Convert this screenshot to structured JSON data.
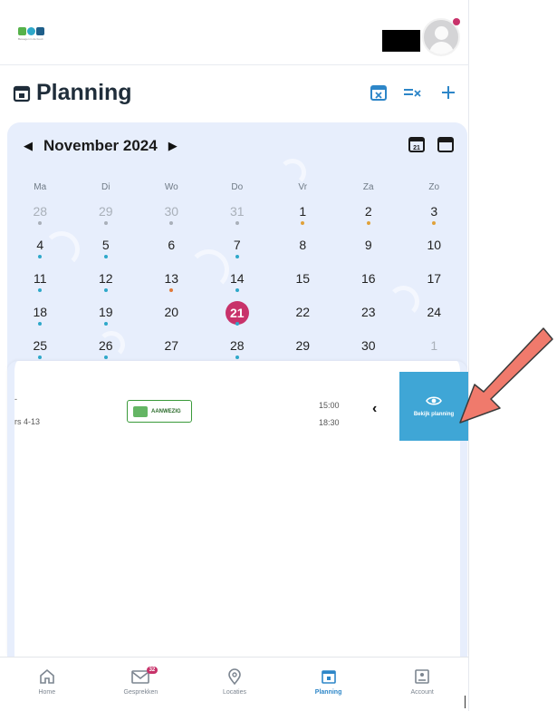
{
  "app": {
    "logo_text": "Bewegen in de buurt"
  },
  "header": {
    "title": "Planning"
  },
  "colors": {
    "accent": "#2d86c8",
    "today": "#c8326a",
    "calendar_bg": "#e7eefc",
    "button": "#3fa6d6",
    "annotation": "#f07a6c"
  },
  "calendar": {
    "month_label": "November 2024",
    "weekdays": [
      "Ma",
      "Di",
      "Wo",
      "Do",
      "Vr",
      "Za",
      "Zo"
    ],
    "days": [
      {
        "n": "28",
        "muted": true,
        "dot": "#a9b0b9"
      },
      {
        "n": "29",
        "muted": true,
        "dot": "#a9b0b9"
      },
      {
        "n": "30",
        "muted": true,
        "dot": "#a9b0b9"
      },
      {
        "n": "31",
        "muted": true,
        "dot": "#a9b0b9"
      },
      {
        "n": "1",
        "dot": "#e0a23a"
      },
      {
        "n": "2",
        "dot": "#e0a23a"
      },
      {
        "n": "3",
        "dot": "#e0a23a"
      },
      {
        "n": "4",
        "dot": "#2ea8c9"
      },
      {
        "n": "5",
        "dot": "#2ea8c9"
      },
      {
        "n": "6"
      },
      {
        "n": "7",
        "dot": "#2ea8c9"
      },
      {
        "n": "8"
      },
      {
        "n": "9"
      },
      {
        "n": "10"
      },
      {
        "n": "11",
        "dot": "#2ea8c9"
      },
      {
        "n": "12",
        "dot": "#2ea8c9"
      },
      {
        "n": "13",
        "dot": "#e07a3a"
      },
      {
        "n": "14",
        "dot": "#2ea8c9"
      },
      {
        "n": "15"
      },
      {
        "n": "16"
      },
      {
        "n": "17"
      },
      {
        "n": "18",
        "dot": "#2ea8c9"
      },
      {
        "n": "19",
        "dot": "#2ea8c9"
      },
      {
        "n": "20"
      },
      {
        "n": "21",
        "today": true,
        "dot": "#2ea8c9"
      },
      {
        "n": "22"
      },
      {
        "n": "23"
      },
      {
        "n": "24"
      },
      {
        "n": "25",
        "dot": "#2ea8c9"
      },
      {
        "n": "26",
        "dot": "#2ea8c9"
      },
      {
        "n": "27"
      },
      {
        "n": "28",
        "dot": "#2ea8c9"
      },
      {
        "n": "29"
      },
      {
        "n": "30"
      },
      {
        "n": "1",
        "muted": true
      }
    ]
  },
  "list": {
    "row": {
      "title_fragment": "-",
      "subtitle_fragment": "rs 4-13",
      "status": "AANWEZIG",
      "start_time": "15:00",
      "end_time": "18:30",
      "action_label": "Bekijk planning"
    }
  },
  "nav": {
    "items": [
      {
        "label": "Home",
        "icon": "home-icon"
      },
      {
        "label": "Gesprekken",
        "icon": "messages-icon",
        "badge": "32"
      },
      {
        "label": "Locaties",
        "icon": "location-icon"
      },
      {
        "label": "Planning",
        "icon": "calendar-icon",
        "active": true
      },
      {
        "label": "Account",
        "icon": "account-icon"
      }
    ]
  }
}
